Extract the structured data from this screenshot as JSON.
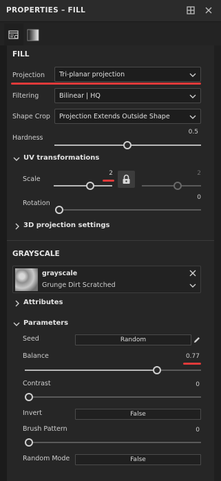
{
  "window": {
    "title": "PROPERTIES – FILL"
  },
  "fill": {
    "heading": "FILL",
    "projection": {
      "label": "Projection",
      "value": "Tri-planar projection"
    },
    "filtering": {
      "label": "Filtering",
      "value": "Bilinear | HQ"
    },
    "shape_crop": {
      "label": "Shape Crop",
      "value": "Projection Extends Outside Shape"
    },
    "hardness": {
      "label": "Hardness",
      "value": "0.5",
      "level": 0.5
    },
    "uv": {
      "heading": "UV transformations",
      "scale": {
        "label": "Scale",
        "value_left": "2",
        "value_right": "2",
        "level": 0.75
      },
      "rotation": {
        "label": "Rotation",
        "value": "0",
        "level": 0.0
      }
    },
    "projection3d": {
      "heading": "3D projection settings"
    }
  },
  "grayscale": {
    "heading": "GRAYSCALE",
    "resource": {
      "name": "grayscale",
      "subtitle": "Grunge Dirt Scratched"
    },
    "attributes": {
      "heading": "Attributes"
    },
    "parameters": {
      "heading": "Parameters",
      "seed": {
        "label": "Seed",
        "button": "Random"
      },
      "balance": {
        "label": "Balance",
        "value": "0.77",
        "level": 0.77
      },
      "contrast": {
        "label": "Contrast",
        "value": "0",
        "level": 0.0
      },
      "invert": {
        "label": "Invert",
        "value": "False"
      },
      "brush_pattern": {
        "label": "Brush Pattern",
        "value": "0",
        "level": 0.0
      },
      "random_mode": {
        "label": "Random Mode",
        "value": "False"
      }
    }
  },
  "icons": {
    "maximize": "maximize-icon",
    "close": "close-icon",
    "tab_properties": "properties-tab-icon",
    "tab_grayscale": "grayscale-tab-icon",
    "lock": "lock-icon",
    "pencil": "pencil-icon",
    "chevron": "chevron-down-icon"
  },
  "colors": {
    "annotation_red": "#e03a3a",
    "panel_bg": "#262626",
    "window_bg": "#1b1b1b"
  }
}
